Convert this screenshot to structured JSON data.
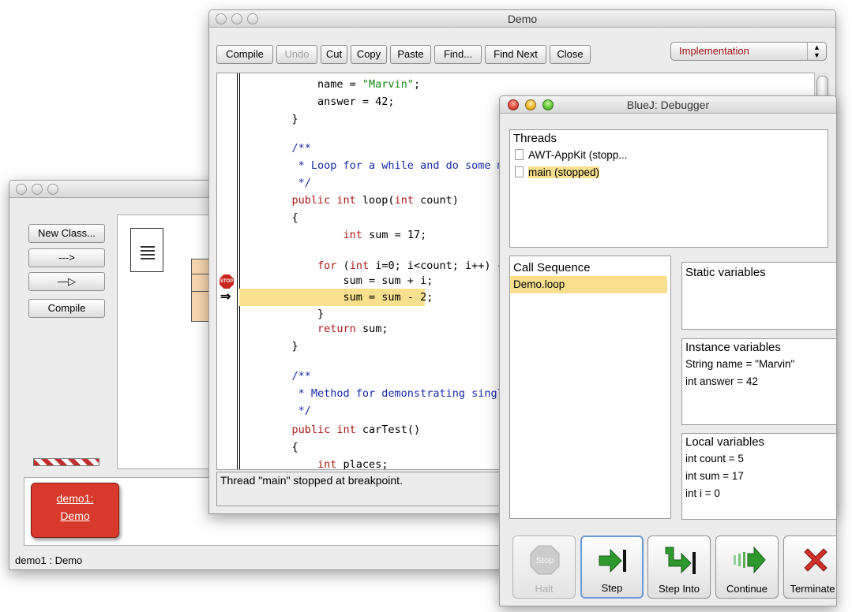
{
  "project_window": {
    "buttons": {
      "new_class": "New Class...",
      "dep_arrow": "--->",
      "inherit_arrow": "—▷",
      "compile": "Compile"
    },
    "object": {
      "name": "demo1:",
      "type": "Demo"
    },
    "status": "demo1 : Demo"
  },
  "editor_window": {
    "title": "Demo",
    "toolbar": {
      "compile": "Compile",
      "undo": "Undo",
      "cut": "Cut",
      "copy": "Copy",
      "paste": "Paste",
      "find": "Find...",
      "find_next": "Find Next",
      "close": "Close"
    },
    "view_selector": "Implementation",
    "breakpoint_label": "STOP",
    "status": "Thread \"main\" stopped at breakpoint."
  },
  "debugger_window": {
    "title": "BlueJ:  Debugger",
    "threads": {
      "header": "Threads",
      "items": [
        "AWT-AppKit (stopp...",
        "main (stopped)"
      ]
    },
    "call_sequence": {
      "header": "Call Sequence",
      "items": [
        "Demo.loop"
      ]
    },
    "static_vars": {
      "header": "Static variables"
    },
    "instance_vars": {
      "header": "Instance variables",
      "items": [
        "String name = \"Marvin\"",
        "int answer = 42"
      ]
    },
    "local_vars": {
      "header": "Local variables",
      "items": [
        "int count = 5",
        "int sum = 17",
        "int i = 0"
      ]
    },
    "buttons": {
      "halt": "Halt",
      "halt_icon_text": "Stop",
      "step": "Step",
      "step_into": "Step Into",
      "continue": "Continue",
      "terminate": "Terminate"
    }
  },
  "colors": {
    "highlight": "#f9e08e",
    "keyword": "#aa1a1a",
    "comment": "#1a2aa8",
    "string": "#128a12",
    "object_red": "#d9392a"
  }
}
